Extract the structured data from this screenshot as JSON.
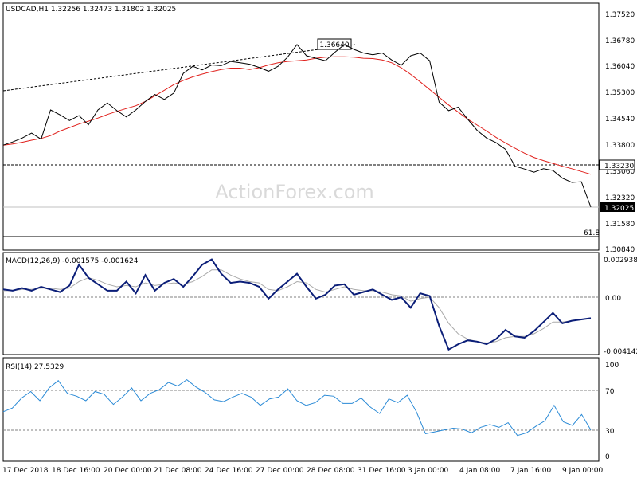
{
  "colors": {
    "background": "#ffffff",
    "price": "#000000",
    "ma": "#e0201c",
    "macd": "#0b1e78",
    "signal": "#aaaaaa",
    "rsi": "#2a8ad6",
    "axis": "#000000",
    "refline": "#808080"
  },
  "chart_data": [
    {
      "type": "line",
      "title": "USDCAD,H1  1.32256 1.32473 1.31802 1.32025",
      "watermark": "ActionForex.com",
      "y_ticks": [
        "1.37520",
        "1.36780",
        "1.36040",
        "1.35300",
        "1.34540",
        "1.33800",
        "1.33060",
        "1.32320",
        "1.31580",
        "1.30840"
      ],
      "ylim": [
        1.3084,
        1.3752
      ],
      "price_tags": [
        "1.33230",
        "1.32025"
      ],
      "annotations": [
        "1.36640",
        "61.8"
      ],
      "x_ticks": [
        "17 Dec 2018",
        "18 Dec 16:00",
        "20 Dec 00:00",
        "21 Dec 08:00",
        "24 Dec 16:00",
        "27 Dec 00:00",
        "28 Dec 08:00",
        "31 Dec 16:00",
        "3 Jan 00:00",
        "4 Jan 08:00",
        "7 Jan 16:00",
        "9 Jan 00:00"
      ],
      "series": [
        {
          "values": [
            1.3378,
            1.3387,
            1.3398,
            1.3412,
            1.3395,
            1.3478,
            1.3464,
            1.3448,
            1.3462,
            1.3436,
            1.3478,
            1.3498,
            1.3476,
            1.3458,
            1.3478,
            1.3502,
            1.3522,
            1.3508,
            1.3526,
            1.3582,
            1.3602,
            1.3592,
            1.3606,
            1.3604,
            1.3616,
            1.3612,
            1.3608,
            1.3599,
            1.3588,
            1.3602,
            1.3628,
            1.3664,
            1.3632,
            1.3625,
            1.3618,
            1.3642,
            1.3664,
            1.365,
            1.364,
            1.3635,
            1.364,
            1.362,
            1.3605,
            1.3632,
            1.364,
            1.3618,
            1.35,
            1.3476,
            1.3486,
            1.3452,
            1.342,
            1.3398,
            1.3385,
            1.3366,
            1.3318,
            1.331,
            1.3301,
            1.3311,
            1.3306,
            1.3284,
            1.3272,
            1.3274,
            1.3202
          ]
        },
        {
          "values": [
            1.3378,
            1.3381,
            1.3386,
            1.3392,
            1.3397,
            1.3405,
            1.3418,
            1.3428,
            1.3438,
            1.3446,
            1.3455,
            1.3465,
            1.3474,
            1.3482,
            1.349,
            1.3502,
            1.3518,
            1.3534,
            1.355,
            1.3562,
            1.3572,
            1.358,
            1.3587,
            1.3593,
            1.3597,
            1.3597,
            1.3593,
            1.3598,
            1.3606,
            1.3612,
            1.3616,
            1.3618,
            1.362,
            1.3625,
            1.3628,
            1.3629,
            1.3629,
            1.3628,
            1.3625,
            1.3624,
            1.362,
            1.3612,
            1.3598,
            1.3579,
            1.3558,
            1.3536,
            1.3514,
            1.3492,
            1.3472,
            1.3452,
            1.3435,
            1.3418,
            1.34,
            1.3384,
            1.3369,
            1.3355,
            1.3343,
            1.3334,
            1.3326,
            1.3318,
            1.3311,
            1.3303,
            1.3295
          ]
        }
      ]
    },
    {
      "type": "line",
      "title": "MACD(12,26,9) -0.001575 -0.001624",
      "y_ticks": [
        "0.002938",
        "0.00",
        "-0.004142"
      ],
      "ylim": [
        -0.004142,
        0.002938
      ],
      "series": [
        {
          "values": [
            0.0006,
            0.0005,
            0.0007,
            0.0005,
            0.0008,
            0.0006,
            0.0004,
            0.0009,
            0.0025,
            0.0015,
            0.001,
            0.0005,
            0.0005,
            0.0012,
            0.0003,
            0.0017,
            0.0005,
            0.0011,
            0.0014,
            0.0008,
            0.0016,
            0.0025,
            0.0029,
            0.0018,
            0.0011,
            0.0012,
            0.0011,
            0.0008,
            -0.0001,
            0.0006,
            0.0012,
            0.0018,
            0.0008,
            -0.0001,
            0.0002,
            0.0009,
            0.001,
            0.0002,
            0.0004,
            0.0006,
            0.0002,
            -0.0002,
            0.0,
            -0.0008,
            0.0003,
            0.0001,
            -0.0022,
            -0.004,
            -0.0036,
            -0.0033,
            -0.0034,
            -0.0036,
            -0.0032,
            -0.0025,
            -0.003,
            -0.0031,
            -0.0026,
            -0.0019,
            -0.0012,
            -0.002,
            -0.0018,
            -0.0017,
            -0.0016
          ]
        },
        {
          "values": [
            0.0005,
            0.0005,
            0.0006,
            0.0006,
            0.0007,
            0.0007,
            0.0006,
            0.0007,
            0.0012,
            0.0015,
            0.0013,
            0.001,
            0.0008,
            0.0009,
            0.0008,
            0.0011,
            0.0009,
            0.001,
            0.0011,
            0.001,
            0.0012,
            0.0016,
            0.0021,
            0.0021,
            0.0017,
            0.0014,
            0.0012,
            0.0011,
            0.0006,
            0.0005,
            0.0008,
            0.0012,
            0.0011,
            0.0006,
            0.0004,
            0.0006,
            0.0008,
            0.0006,
            0.0005,
            0.0005,
            0.0004,
            0.0002,
            0.0001,
            -0.0003,
            -0.0001,
            0.0,
            -0.0008,
            -0.002,
            -0.0028,
            -0.0032,
            -0.0034,
            -0.0035,
            -0.0034,
            -0.0031,
            -0.003,
            -0.003,
            -0.0028,
            -0.0024,
            -0.0019,
            -0.0019,
            -0.0018,
            -0.0017,
            -0.0016
          ]
        }
      ]
    },
    {
      "type": "line",
      "title": "RSI(14) 27.5329",
      "y_ticks": [
        "100",
        "70",
        "30",
        "0"
      ],
      "ylim": [
        0,
        100
      ],
      "series": [
        {
          "values": [
            48,
            52,
            63,
            70,
            60,
            74,
            82,
            68,
            65,
            60,
            70,
            67,
            56,
            64,
            74,
            60,
            68,
            72,
            80,
            76,
            83,
            75,
            69,
            61,
            59,
            64,
            68,
            64,
            55,
            62,
            64,
            73,
            60,
            55,
            58,
            66,
            65,
            57,
            57,
            63,
            53,
            46,
            62,
            58,
            66,
            48,
            24,
            26,
            28,
            30,
            29,
            25,
            31,
            34,
            31,
            36,
            22,
            25,
            32,
            38,
            55,
            37,
            33,
            45,
            28
          ]
        }
      ]
    }
  ]
}
